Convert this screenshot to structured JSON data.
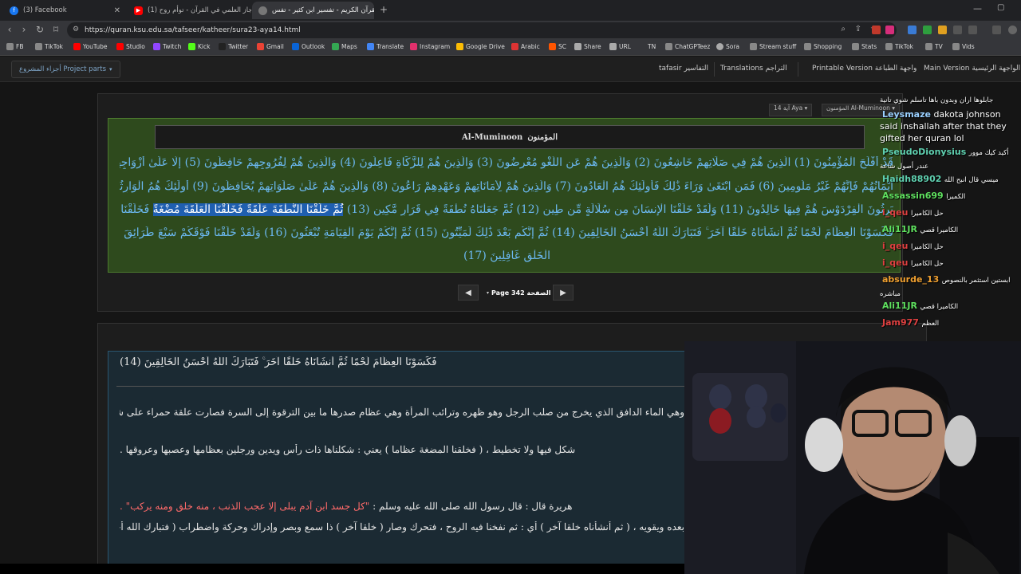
{
  "browser": {
    "tabs": [
      {
        "label": "(3) Facebook",
        "icon": "facebook-icon",
        "color": "#1877f2",
        "active": false
      },
      {
        "label": "(1) الإعجاز العلمي في القرآن - توأم روح...",
        "icon": "youtube-icon",
        "color": "#ff0000",
        "active": false
      },
      {
        "label": "القرآن الكريم - تفسير ابن كثير - تفس",
        "icon": "site-icon",
        "color": "#777777",
        "active": true
      }
    ],
    "url": "https://quran.ksu.edu.sa/tafseer/katheer/sura23-aya14.html",
    "bookmarks": [
      "FB",
      "TikTok",
      "YouTube",
      "Studio",
      "Twitch",
      "Kick",
      "Twitter",
      "Gmail",
      "Outlook",
      "Maps",
      "Translate",
      "Instagram",
      "Google Drive",
      "Arabic",
      "SC",
      "Share",
      "URL",
      "TN",
      "ChatGPTeez",
      "Sora",
      "Stream stuff",
      "Shopping",
      "Stats",
      "TikTok",
      "TV",
      "Vids"
    ]
  },
  "site_nav": {
    "project_parts": "أجزاء المشروع Project parts",
    "tafasir": "tafasir التفاسير",
    "translations": "Translations التراجم",
    "printable": "Printable Version واجهة الطباعة",
    "main": "Main Version الواجهة الرئيسية"
  },
  "quran_view": {
    "aya_select": "آية 14 Aya",
    "sura_select": "المؤمنون Al-Muminoon",
    "surah_arabic": "المؤمنون",
    "surah_latin": "Al-Muminoon",
    "lines": [
      "قَدْ أَفْلَحَ الْمُؤْمِنُونَ (1) الَّذِينَ هُمْ فِي صَلَاتِهِمْ خَاشِعُونَ (2) وَالَّذِينَ هُمْ عَنِ اللَّغْوِ مُعْرِضُونَ (3) وَالَّذِينَ هُمْ لِلزَّكَاةِ فَاعِلُونَ (4) وَالَّذِينَ هُمْ لِفُرُوجِهِمْ حَافِظُونَ (5) إِلَّا عَلَىٰ أَزْوَاجِهِمْ أَوْ مَا مَلَكَتْ",
      "أَيْمَانُهُمْ فَإِنَّهُمْ غَيْرُ مَلُومِينَ (6) فَمَنِ ابْتَغَىٰ وَرَاءَ ذَٰلِكَ فَأُولَٰئِكَ هُمُ الْعَادُونَ (7) وَالَّذِينَ هُمْ لِأَمَانَاتِهِمْ وَعَهْدِهِمْ رَاعُونَ (8) وَالَّذِينَ هُمْ عَلَىٰ صَلَوَاتِهِمْ يُحَافِظُونَ (9) أُولَٰئِكَ هُمُ الْوَارِثُونَ (10) الَّذِينَ",
      "يَرِثُونَ الْفِرْدَوْسَ هُمْ فِيهَا خَالِدُونَ (11) وَلَقَدْ خَلَقْنَا الْإِنسَانَ مِن سُلَالَةٍ مِّن طِينٍ (12) ثُمَّ جَعَلْنَاهُ نُطْفَةً فِي قَرَارٍ مَّكِينٍ (13)",
      "فَكَسَوْنَا الْعِظَامَ لَحْمًا ثُمَّ أَنشَأْنَاهُ خَلْقًا آخَرَ ۚ فَتَبَارَكَ اللَّهُ أَحْسَنُ الْخَالِقِينَ (14) ثُمَّ إِنَّكُم بَعْدَ ذَٰلِكَ لَمَيِّتُونَ (15) ثُمَّ إِنَّكُمْ يَوْمَ الْقِيَامَةِ تُبْعَثُونَ (16) وَلَقَدْ خَلَقْنَا فَوْقَكُمْ سَبْعَ طَرَائِقَ وَمَا كُنَّا عَنِ",
      "الْخَلْقِ غَافِلِينَ (17)"
    ],
    "highlight": "ثُمَّ خَلَقْنَا النُّطْفَةَ عَلَقَةً فَخَلَقْنَا الْعَلَقَةَ مُضْغَةً",
    "highlight_rest": " فَخَلَقْنَا الْمُضْغَةَ عِظَامًا",
    "page_label": "Page 342 الصفحة",
    "colors": {
      "quran_text": "#6bb8f0",
      "highlight": "#1f5fb0",
      "quran_bg": "#2e4a1d"
    }
  },
  "tafsir": {
    "ayah": "فَكَسَوْنَا الْعِظَامَ لَحْمًا ثُمَّ أَنشَأْنَاهُ خَلْقًا آخَرَ ۚ فَتَبَارَكَ اللَّهُ أَحْسَنُ الْخَالِقِينَ (14)",
    "lines": [
      "وهي الماء الدافق الذي يخرج من صلب الرجل وهو ظهره وترائب المرأة وهي عظام صدرها ما بين الترقوة إلى السرة فصارت علقة حمراء على شكل",
      "شكل فيها ولا تخطيط ، ( فخلقنا المضغة عظاما ) يعني : شكلناها ذات رأس ويدين ورجلين بعظامها وعصبها وعروقها .",
      "",
      "هريرة قال : قال رسول الله صلى الله عليه وسلم :",
      "بعده ويقويه ، ( ثم أنشأناه خلقا آخر ) أي : ثم نفخنا فيه الروح ، فتحرك وصار ( خلقا آخر ) ذا سمع وبصر وإدراك وحركة واضطراب ( فتبارك الله أحسن"
    ],
    "hadith": "\"كل جسد ابن آدم يبلى إلا عجب الذنب ، منه خلق ومنه يركب\" ."
  },
  "chat": [
    {
      "user": "",
      "msg": "جابلوها اران وبدون باها تاسلم شوي تانية",
      "color": "#ffffff"
    },
    {
      "user": "Leysmaze",
      "msg": "dakota johnson said inshallah after that they gifted her quran lol",
      "color": "#9ad0ff"
    },
    {
      "user": "PseudoDionysius",
      "msg": "أكيد كيك موور",
      "color": "#5fd0b0"
    },
    {
      "user": "",
      "msg": "عندر أصول شاعة",
      "color": "#ffffff"
    },
    {
      "user": "Haidh88902",
      "msg": "ميسي قال انبح الله",
      "color": "#5fd0b0"
    },
    {
      "user": "Assassin699",
      "msg": "الكميرا",
      "color": "#5fe05f"
    },
    {
      "user": "i_qeu",
      "msg": "حل الكاميرا",
      "color": "#e04040"
    },
    {
      "user": "Ali11JR",
      "msg": "الكاميرا قصي",
      "color": "#5fe05f"
    },
    {
      "user": "i_qeu",
      "msg": "حل الكاميرا",
      "color": "#e04040"
    },
    {
      "user": "i_qeu",
      "msg": "حل الكاميرا",
      "color": "#e04040"
    },
    {
      "user": "absurde_13",
      "msg": "ابستين استثمر بالنصوص مباشره",
      "color": "#f0a030"
    },
    {
      "user": "Ali11JR",
      "msg": "الكاميرا قصي",
      "color": "#5fe05f"
    },
    {
      "user": "Jam977",
      "msg": "العظم",
      "color": "#e04040"
    }
  ]
}
